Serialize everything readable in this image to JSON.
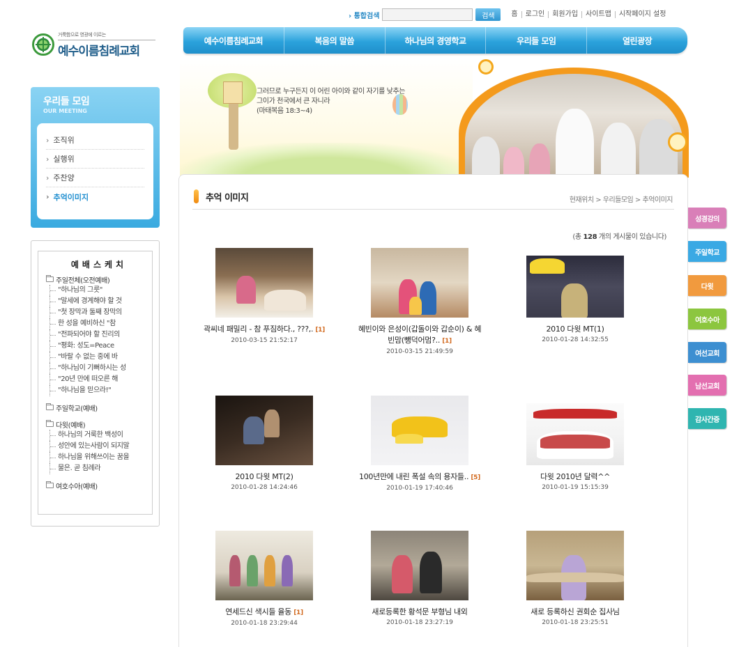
{
  "utility": {
    "search_label": "통합검색",
    "search_value": "",
    "search_button": "검색",
    "links": [
      "홈",
      "로그인",
      "회원가입",
      "사이트맵",
      "시작페이지 설정"
    ]
  },
  "logo": {
    "slogan": "거룩함으로 영광에 이르는",
    "name": "예수이름침례교회"
  },
  "nav": [
    "예수이름침례교회",
    "복음의 말씀",
    "하나님의 경영학교",
    "우리들 모임",
    "열린광장"
  ],
  "leftmenu": {
    "title": "우리들 모임",
    "subtitle": "OUR MEETING",
    "items": [
      {
        "label": "조직위",
        "active": false
      },
      {
        "label": "실행위",
        "active": false
      },
      {
        "label": "주찬양",
        "active": false
      },
      {
        "label": "추억이미지",
        "active": true
      }
    ]
  },
  "sketch": {
    "title": "예배스케치",
    "groups": [
      {
        "label": "주일전체(오전예배)",
        "items": [
          "\"하나님의 그릇\"",
          "\"말세에 경계해야 할 것",
          "\"첫 장막과 둘째 장막의",
          "한 성을 예비하신 \"참",
          "\"전파되어야 할 진리의",
          "\"평화: 성도=Peace",
          "\"바랄 수 없는 중에 바",
          "\"하나님이 기뻐하시는 성",
          "\"20년 만에 떠오른 해",
          "\"하나님을 믿으라!\""
        ]
      },
      {
        "label": "주일학교(예배)",
        "items": []
      },
      {
        "label": "다윗(예배)",
        "items": [
          "하나님의 거룩한 백성이",
          "성안에 있는사람이 되지말",
          "하나님을 위해쓰이는 꿈을",
          "물은. 곧 침례라"
        ]
      },
      {
        "label": "여호수아(예배)",
        "items": []
      }
    ]
  },
  "banner": {
    "verse": [
      "그러므로 누구든지 이 어린 아이와 같이 자기를 낮추는",
      "그이가 천국에서 큰 자니라",
      "(마태복음 18:3~4)"
    ]
  },
  "content": {
    "title": "추억 이미지",
    "breadcrumb": "현재위치 > 우리들모임 > 추억이미지",
    "count_prefix": "(총 ",
    "count": "128",
    "count_suffix": " 개의 게시물이 있습니다)"
  },
  "gallery": [
    {
      "title": "곽씨네 패밀리 - 참 푸짐하다., ???,.",
      "comments": "[1]",
      "date": "2010-03-15 21:52:17",
      "theme": "family"
    },
    {
      "title": "혜빈이와 은성이(갑돌이와 갑순이) & 혜빈맘(뺑덕어멈?..",
      "comments": "[1]",
      "date": "2010-03-15 21:49:59",
      "theme": "hanbok"
    },
    {
      "title": "2010 다윗 MT(1)",
      "comments": "",
      "date": "2010-01-28 14:32:55",
      "theme": "mvp"
    },
    {
      "title": "2010 다윗 MT(2)",
      "comments": "",
      "date": "2010-01-28 14:24:46",
      "theme": "night"
    },
    {
      "title": "100년만에 내린 폭설 속의 용자들..",
      "comments": "[5]",
      "date": "2010-01-19 17:40:46",
      "theme": "snow"
    },
    {
      "title": "다윗 2010년 달력^^",
      "comments": "",
      "date": "2010-01-19 15:15:39",
      "theme": "calendar"
    },
    {
      "title": "연세드신 색시들 율동",
      "comments": "[1]",
      "date": "2010-01-18 23:29:44",
      "theme": "dance"
    },
    {
      "title": "새로등록한 황석문 부형님 내외",
      "comments": "",
      "date": "2010-01-18 23:27:19",
      "theme": "couple"
    },
    {
      "title": "새로 등록하신 권회순 집사님",
      "comments": "",
      "date": "2010-01-18 23:25:51",
      "theme": "pews"
    }
  ],
  "quicktabs": [
    {
      "label": "성경강의",
      "color": "#d97fb8"
    },
    {
      "label": "주일학교",
      "color": "#3aa9e4"
    },
    {
      "label": "다윗",
      "color": "#f19a3e"
    },
    {
      "label": "여호수아",
      "color": "#8cc63f"
    },
    {
      "label": "여선교회",
      "color": "#3d8fd1"
    },
    {
      "label": "남선교회",
      "color": "#e36fb0"
    },
    {
      "label": "감사간증",
      "color": "#2fb5b0"
    }
  ]
}
